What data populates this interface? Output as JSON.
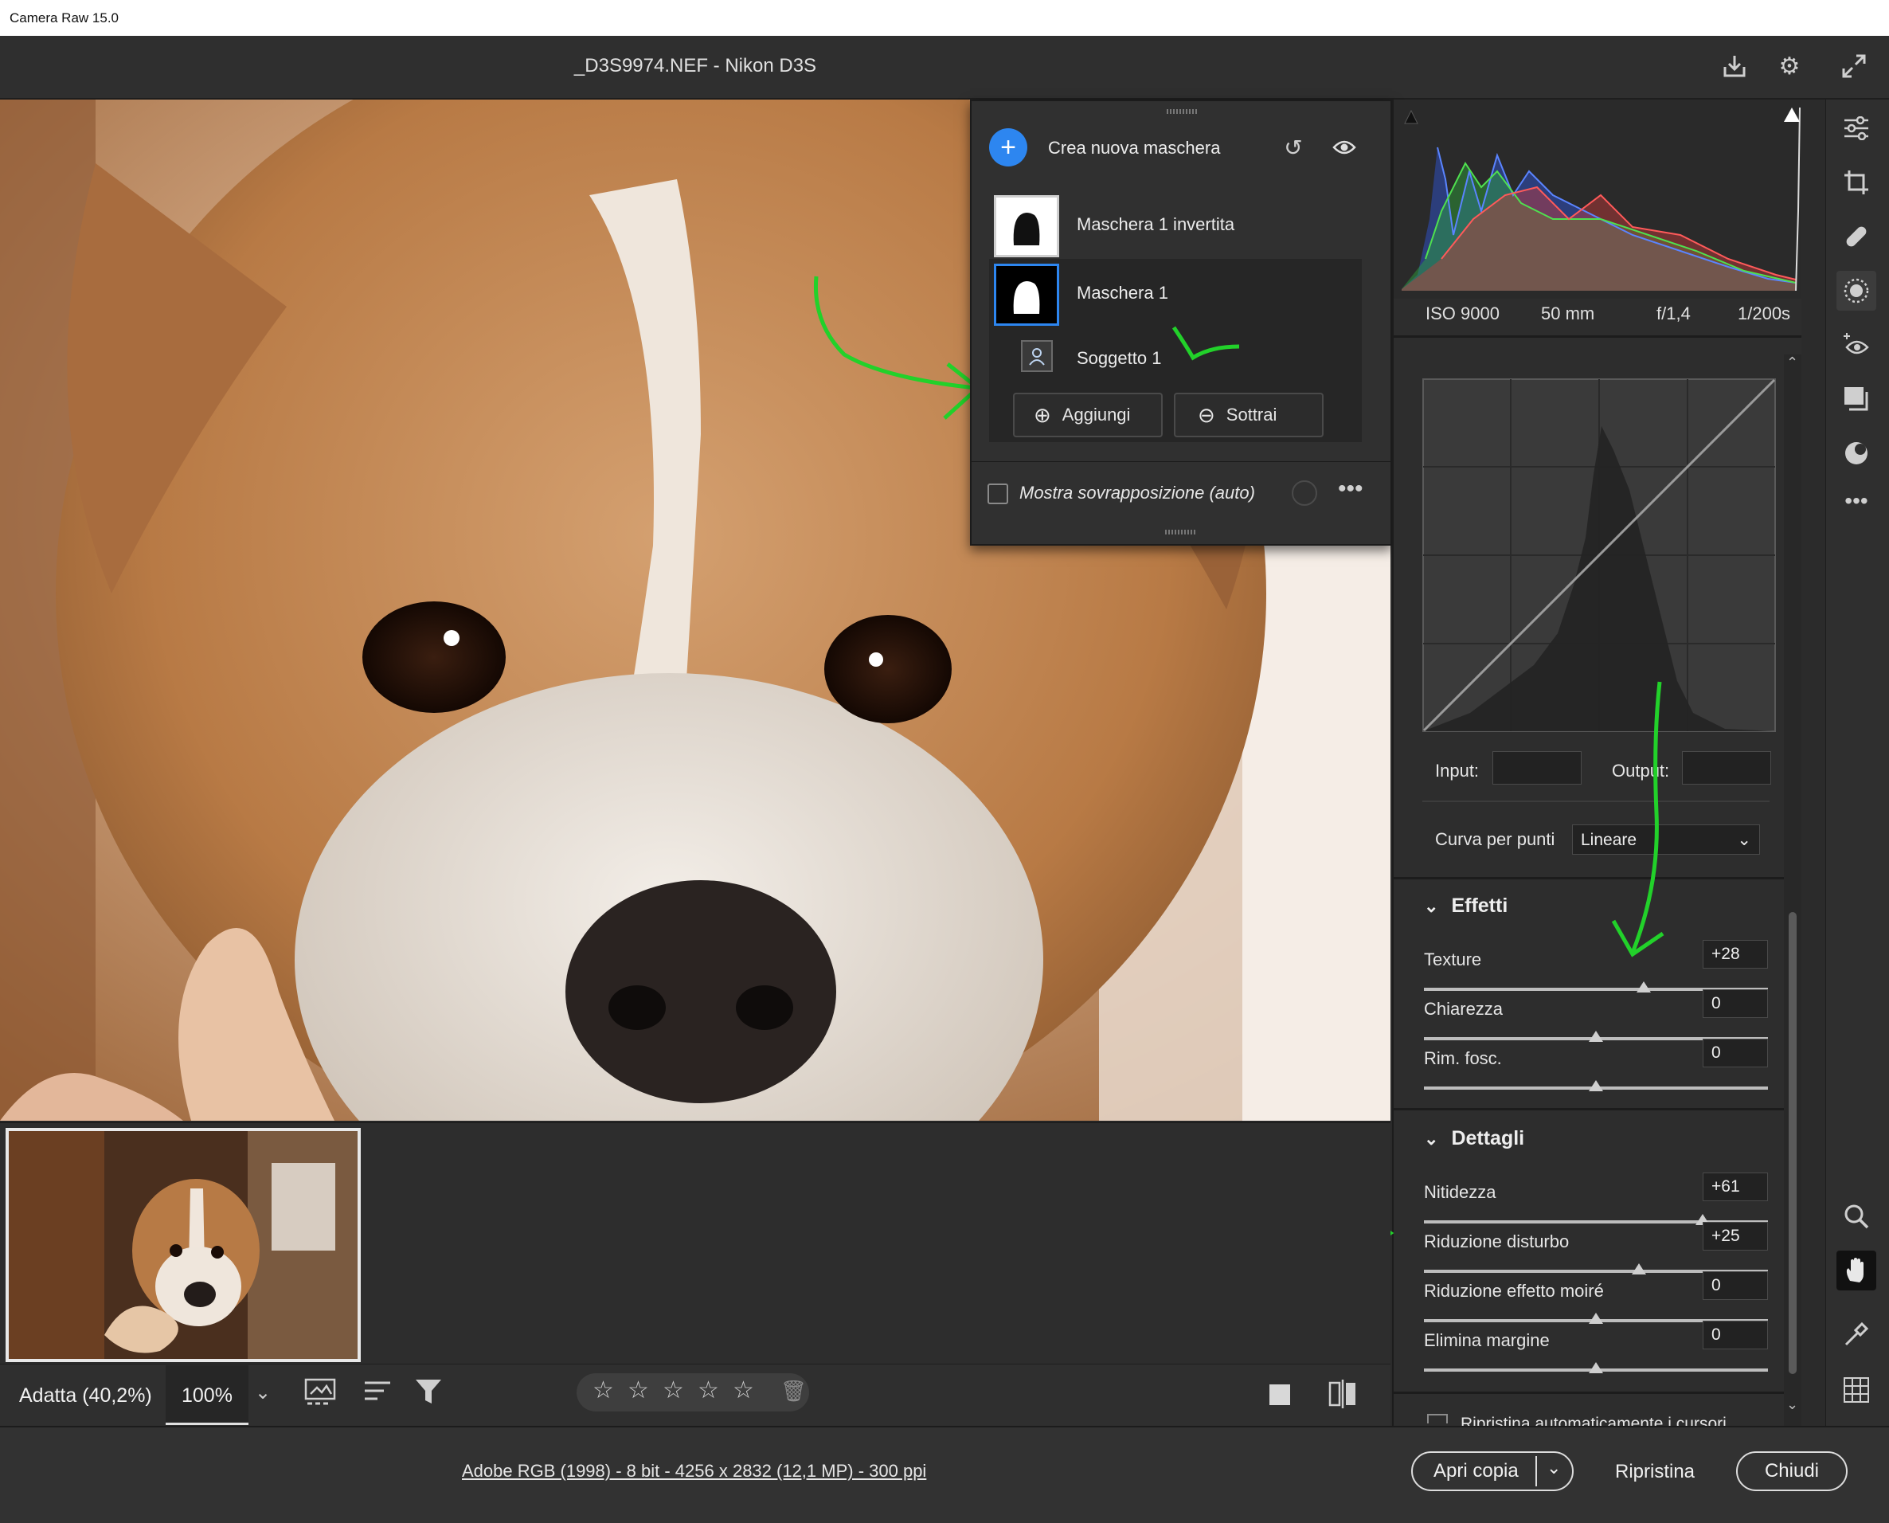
{
  "window": {
    "title": "Camera Raw 15.0"
  },
  "header": {
    "file_title": "_D3S9974.NEF  -  Nikon D3S"
  },
  "icons": {
    "download": "download-icon",
    "settings": "gear-icon",
    "fullscreen": "fullscreen-icon"
  },
  "mask_panel": {
    "create_label": "Crea nuova maschera",
    "masks": [
      {
        "label": "Maschera 1 invertita"
      },
      {
        "label": "Maschera 1"
      }
    ],
    "component": "Soggetto 1",
    "add_label": "Aggiungi",
    "subtract_label": "Sottrai",
    "overlay_label": "Mostra sovrapposizione (auto)"
  },
  "histogram": {
    "iso": "ISO 9000",
    "focal": "50 mm",
    "aperture": "f/1,4",
    "shutter": "1/200s"
  },
  "curve": {
    "input_label": "Input:",
    "output_label": "Output:",
    "point_curve_label": "Curva per punti",
    "point_curve_value": "Lineare"
  },
  "effects": {
    "title": "Effetti",
    "sliders": [
      {
        "label": "Texture",
        "value": "+28",
        "level": 0.64
      },
      {
        "label": "Chiarezza",
        "value": "0",
        "level": 0.5
      },
      {
        "label": "Rim. fosc.",
        "value": "0",
        "level": 0.5
      }
    ]
  },
  "details": {
    "title": "Dettagli",
    "sliders": [
      {
        "label": "Nitidezza",
        "value": "+61",
        "level": 0.81
      },
      {
        "label": "Riduzione disturbo",
        "value": "+25",
        "level": 0.625
      },
      {
        "label": "Riduzione effetto moiré",
        "value": "0",
        "level": 0.5
      },
      {
        "label": "Elimina margine",
        "value": "0",
        "level": 0.5
      }
    ]
  },
  "partial_option": "Ripristina automaticamente i cursori",
  "toolbar": {
    "zoom_fit": "Adatta (40,2%)",
    "zoom_value": "100%",
    "stars": [
      "☆",
      "☆",
      "☆",
      "☆",
      "☆"
    ]
  },
  "status": {
    "info": "Adobe RGB (1998) - 8 bit - 4256 x 2832 (12,1 MP) - 300 ppi",
    "open_copy": "Apri copia",
    "reset": "Ripristina",
    "close": "Chiudi"
  },
  "colors": {
    "accent": "#2d86f0",
    "annotation": "#22d12a",
    "panel_bg": "#2d2d2d"
  }
}
